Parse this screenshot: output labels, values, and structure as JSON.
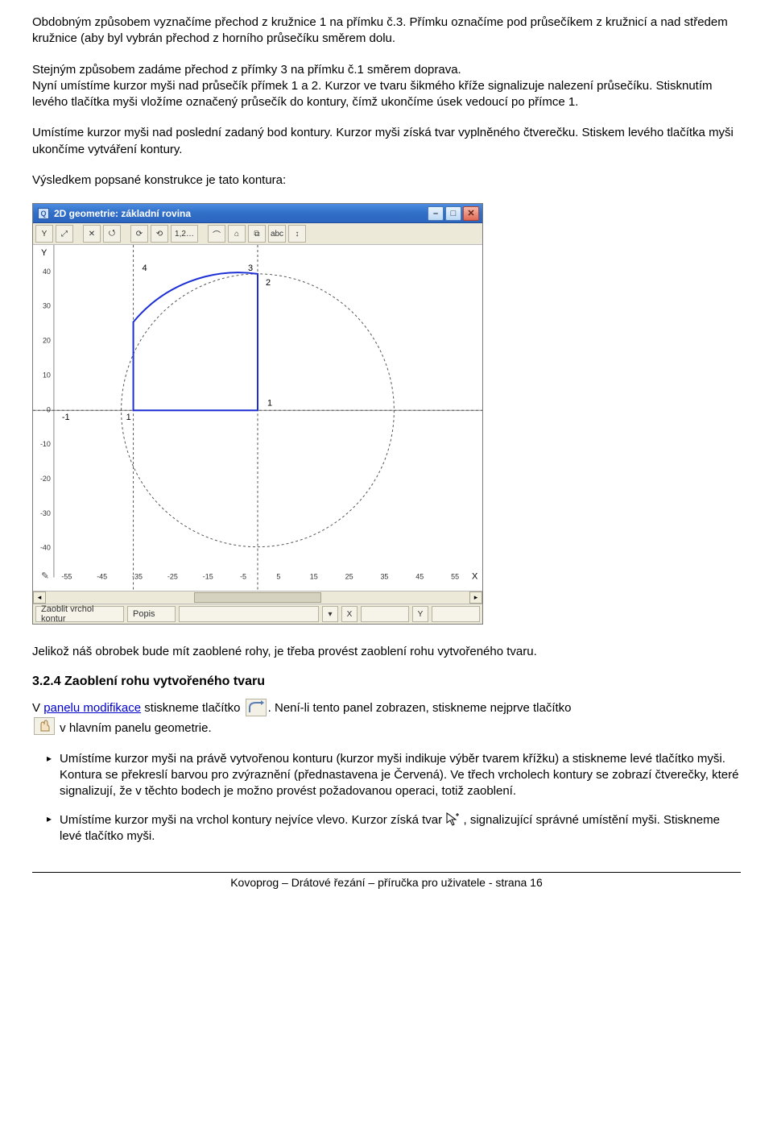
{
  "paragraphs": {
    "p1": "Obdobným způsobem vyznačíme přechod z kružnice 1 na přímku č.3. Přímku označíme pod průsečíkem z kružnicí a nad středem kružnice (aby byl vybrán přechod z horního průsečíku směrem dolu.",
    "p2": "Stejným způsobem zadáme přechod z přímky 3 na přímku č.1 směrem doprava.\nNyní umístíme kurzor myši nad průsečík přímek 1 a 2. Kurzor ve tvaru šikmého kříže signalizuje nalezení průsečíku. Stisknutím levého tlačítka myši vložíme označený průsečík do kontury, čímž ukončíme úsek vedoucí po přímce 1.",
    "p3": "Umístíme kurzor myši nad poslední zadaný bod kontury. Kurzor myši získá tvar vyplněného čtverečku. Stiskem levého tlačítka myši ukončíme vytváření kontury.",
    "p4": "Výsledkem popsané konstrukce je tato kontura:",
    "p5": "Jelikož náš obrobek bude mít zaoblené rohy, je třeba provést zaoblení rohu vytvořeného tvaru.",
    "p6_pre": "V ",
    "p6_link": "panelu modifikace",
    "p6_mid1": " stiskneme tlačítko ",
    "p6_mid2": ". Není-li tento panel zobrazen, stiskneme nejprve tlačítko",
    "p6_tail": " v hlavním panelu geometrie.",
    "li1": "Umístíme kurzor myši na právě vytvořenou konturu (kurzor myši indikuje výběr tvarem křížku) a stiskneme levé tlačítko myši. Kontura se překreslí barvou pro zvýraznění (přednastavena je Červená). Ve třech vrcholech kontury se zobrazí čtverečky, které signalizují, že v těchto bodech je možno provést požadovanou operaci, totiž zaoblení.",
    "li2a": "Umístíme kurzor myši na vrchol kontury nejvíce vlevo. Kurzor získá tvar ",
    "li2b": ", signalizující správné umístění myši. Stiskneme levé tlačítko myši."
  },
  "heading": "3.2.4 Zaoblení rohu vytvořeného tvaru",
  "window": {
    "title": "2D geometrie: základní rovina",
    "toolbar_top_labels": [
      "Y",
      "⤢",
      "",
      "",
      "✕",
      "⭯",
      "⟳",
      "⟲",
      "1,2…",
      "",
      "⌒",
      "⌂",
      "⧉",
      "abc",
      "↕"
    ],
    "x_ticks": [
      "-55",
      "-45",
      "-35",
      "-25",
      "-15",
      "-5",
      "5",
      "15",
      "25",
      "35",
      "45",
      "55"
    ],
    "y_ticks": [
      "40",
      "30",
      "20",
      "10",
      "0",
      "-10",
      "-20",
      "-30",
      "-40"
    ],
    "corner_label_x": "X",
    "corner_label_y": "Y",
    "plot_labels": {
      "four": "4",
      "three": "3",
      "two": "2",
      "one": "1",
      "neg1": "-1",
      "one_b": "1"
    },
    "status": {
      "left": "Zaoblit vrchol kontur",
      "field2": "Popis",
      "x_label": "X",
      "y_label": "Y"
    }
  },
  "footer": "Kovoprog – Drátové řezání – příručka pro uživatele - strana 16"
}
